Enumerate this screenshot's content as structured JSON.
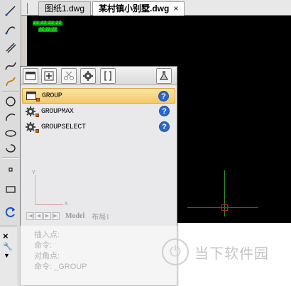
{
  "tabs": [
    {
      "label": "图纸1.dwg",
      "active": false
    },
    {
      "label": "某村镇小别墅.dwg",
      "active": true,
      "close_glyph": "×"
    }
  ],
  "canvas": {
    "text_line_1": "ZZ ZZ ZZ ZZ",
    "text_line_2": "ZZ ZZ ZZ",
    "background": "#000000"
  },
  "panel": {
    "toolbar_icons": [
      "window-icon",
      "add-icon",
      "scissors-icon",
      "settings-icon",
      "brackets-icon",
      "flask-icon"
    ],
    "commands": [
      {
        "label": "GROUP",
        "icon": "window-icon",
        "selected": true,
        "help": "?"
      },
      {
        "label": "GROUPMAX",
        "icon": "gear-icon",
        "selected": false,
        "help": "?"
      },
      {
        "label": "GROUPSELECT",
        "icon": "gear-icon",
        "selected": false,
        "help": "?"
      }
    ],
    "ucs": {
      "y_label": "Y",
      "x_label": "X"
    },
    "layout_tabs": {
      "nav": [
        "|◀",
        "◀",
        "▶",
        "▶|"
      ],
      "model": "Model",
      "layout": "布局1"
    }
  },
  "command_line": {
    "lines": [
      "插入点:",
      "命令:",
      "对角点:",
      "命令: _GROUP"
    ],
    "close_glyph": "×"
  },
  "watermark": {
    "logo_glyph": "⏻",
    "text": "当下软件园"
  }
}
